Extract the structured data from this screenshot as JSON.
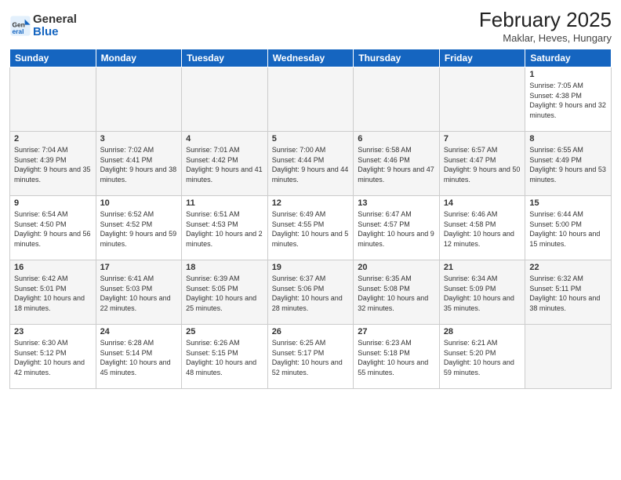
{
  "logo": {
    "general": "General",
    "blue": "Blue"
  },
  "header": {
    "month": "February 2025",
    "location": "Maklar, Heves, Hungary"
  },
  "weekdays": [
    "Sunday",
    "Monday",
    "Tuesday",
    "Wednesday",
    "Thursday",
    "Friday",
    "Saturday"
  ],
  "weeks": [
    [
      {
        "day": "",
        "info": ""
      },
      {
        "day": "",
        "info": ""
      },
      {
        "day": "",
        "info": ""
      },
      {
        "day": "",
        "info": ""
      },
      {
        "day": "",
        "info": ""
      },
      {
        "day": "",
        "info": ""
      },
      {
        "day": "1",
        "info": "Sunrise: 7:05 AM\nSunset: 4:38 PM\nDaylight: 9 hours and 32 minutes."
      }
    ],
    [
      {
        "day": "2",
        "info": "Sunrise: 7:04 AM\nSunset: 4:39 PM\nDaylight: 9 hours and 35 minutes."
      },
      {
        "day": "3",
        "info": "Sunrise: 7:02 AM\nSunset: 4:41 PM\nDaylight: 9 hours and 38 minutes."
      },
      {
        "day": "4",
        "info": "Sunrise: 7:01 AM\nSunset: 4:42 PM\nDaylight: 9 hours and 41 minutes."
      },
      {
        "day": "5",
        "info": "Sunrise: 7:00 AM\nSunset: 4:44 PM\nDaylight: 9 hours and 44 minutes."
      },
      {
        "day": "6",
        "info": "Sunrise: 6:58 AM\nSunset: 4:46 PM\nDaylight: 9 hours and 47 minutes."
      },
      {
        "day": "7",
        "info": "Sunrise: 6:57 AM\nSunset: 4:47 PM\nDaylight: 9 hours and 50 minutes."
      },
      {
        "day": "8",
        "info": "Sunrise: 6:55 AM\nSunset: 4:49 PM\nDaylight: 9 hours and 53 minutes."
      }
    ],
    [
      {
        "day": "9",
        "info": "Sunrise: 6:54 AM\nSunset: 4:50 PM\nDaylight: 9 hours and 56 minutes."
      },
      {
        "day": "10",
        "info": "Sunrise: 6:52 AM\nSunset: 4:52 PM\nDaylight: 9 hours and 59 minutes."
      },
      {
        "day": "11",
        "info": "Sunrise: 6:51 AM\nSunset: 4:53 PM\nDaylight: 10 hours and 2 minutes."
      },
      {
        "day": "12",
        "info": "Sunrise: 6:49 AM\nSunset: 4:55 PM\nDaylight: 10 hours and 5 minutes."
      },
      {
        "day": "13",
        "info": "Sunrise: 6:47 AM\nSunset: 4:57 PM\nDaylight: 10 hours and 9 minutes."
      },
      {
        "day": "14",
        "info": "Sunrise: 6:46 AM\nSunset: 4:58 PM\nDaylight: 10 hours and 12 minutes."
      },
      {
        "day": "15",
        "info": "Sunrise: 6:44 AM\nSunset: 5:00 PM\nDaylight: 10 hours and 15 minutes."
      }
    ],
    [
      {
        "day": "16",
        "info": "Sunrise: 6:42 AM\nSunset: 5:01 PM\nDaylight: 10 hours and 18 minutes."
      },
      {
        "day": "17",
        "info": "Sunrise: 6:41 AM\nSunset: 5:03 PM\nDaylight: 10 hours and 22 minutes."
      },
      {
        "day": "18",
        "info": "Sunrise: 6:39 AM\nSunset: 5:05 PM\nDaylight: 10 hours and 25 minutes."
      },
      {
        "day": "19",
        "info": "Sunrise: 6:37 AM\nSunset: 5:06 PM\nDaylight: 10 hours and 28 minutes."
      },
      {
        "day": "20",
        "info": "Sunrise: 6:35 AM\nSunset: 5:08 PM\nDaylight: 10 hours and 32 minutes."
      },
      {
        "day": "21",
        "info": "Sunrise: 6:34 AM\nSunset: 5:09 PM\nDaylight: 10 hours and 35 minutes."
      },
      {
        "day": "22",
        "info": "Sunrise: 6:32 AM\nSunset: 5:11 PM\nDaylight: 10 hours and 38 minutes."
      }
    ],
    [
      {
        "day": "23",
        "info": "Sunrise: 6:30 AM\nSunset: 5:12 PM\nDaylight: 10 hours and 42 minutes."
      },
      {
        "day": "24",
        "info": "Sunrise: 6:28 AM\nSunset: 5:14 PM\nDaylight: 10 hours and 45 minutes."
      },
      {
        "day": "25",
        "info": "Sunrise: 6:26 AM\nSunset: 5:15 PM\nDaylight: 10 hours and 48 minutes."
      },
      {
        "day": "26",
        "info": "Sunrise: 6:25 AM\nSunset: 5:17 PM\nDaylight: 10 hours and 52 minutes."
      },
      {
        "day": "27",
        "info": "Sunrise: 6:23 AM\nSunset: 5:18 PM\nDaylight: 10 hours and 55 minutes."
      },
      {
        "day": "28",
        "info": "Sunrise: 6:21 AM\nSunset: 5:20 PM\nDaylight: 10 hours and 59 minutes."
      },
      {
        "day": "",
        "info": ""
      }
    ]
  ]
}
